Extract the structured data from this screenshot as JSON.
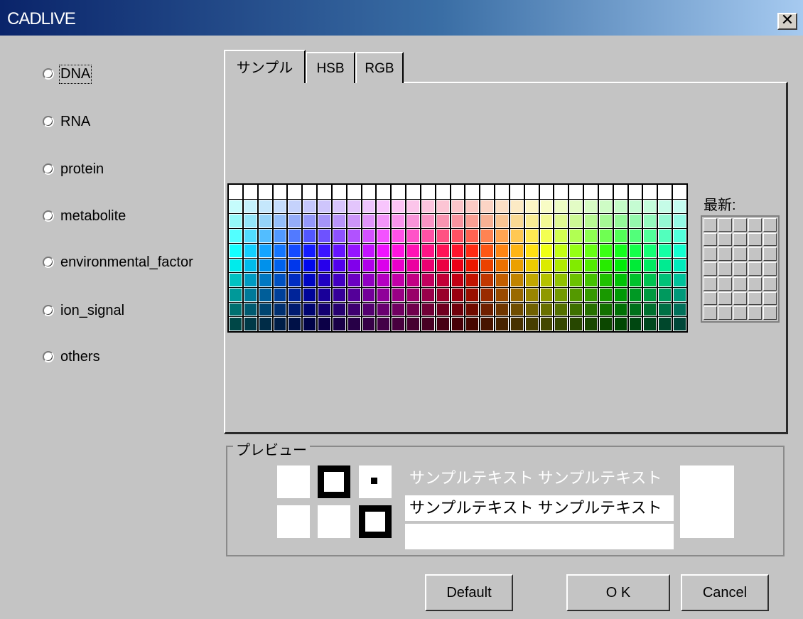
{
  "window": {
    "title": "CADLIVE",
    "close_glyph": "✕"
  },
  "categories": [
    {
      "label": "DNA",
      "selected": false,
      "focused": true
    },
    {
      "label": "RNA",
      "selected": false
    },
    {
      "label": "protein",
      "selected": false
    },
    {
      "label": "metabolite",
      "selected": false
    },
    {
      "label": "environmental_factor",
      "selected": false
    },
    {
      "label": "ion_signal",
      "selected": false
    },
    {
      "label": "others",
      "selected": false
    }
  ],
  "tabs": [
    {
      "label": "サンプル",
      "active": true
    },
    {
      "label": "HSB",
      "active": false
    },
    {
      "label": "RGB",
      "active": false
    }
  ],
  "swatches": {
    "columns": 31,
    "rows": 10
  },
  "recent": {
    "label": "最新:",
    "columns": 5,
    "rows": 7
  },
  "preview": {
    "label": "プレビュー",
    "text_light": "サンプルテキスト サンプルテキスト",
    "text_dark": "サンプルテキスト サンプルテキスト",
    "text_light_color": "#ffffff",
    "text_dark_color": "#000000"
  },
  "buttons": {
    "default": "Default",
    "ok": "O K",
    "cancel": "Cancel"
  }
}
